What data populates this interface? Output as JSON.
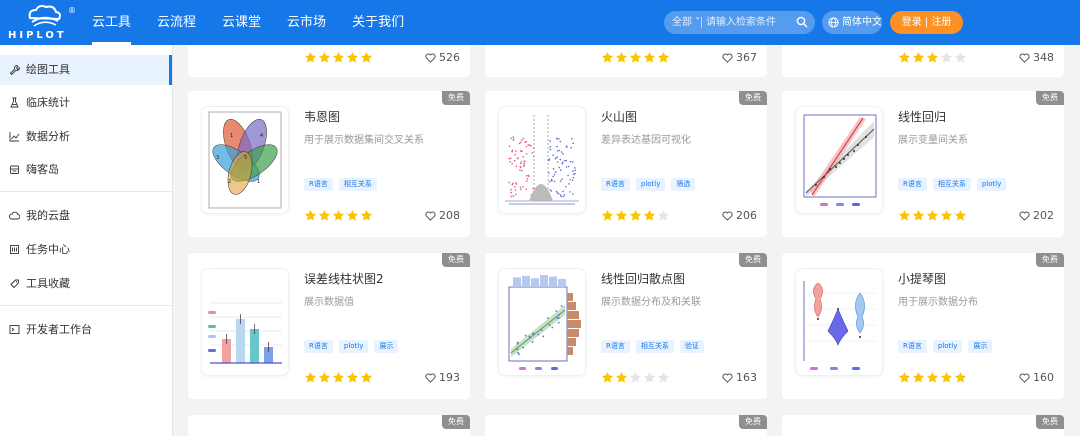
{
  "header": {
    "logo_text": "HIPLOT",
    "logo_reg": "®",
    "nav": [
      {
        "label": "云工具",
        "active": true
      },
      {
        "label": "云流程",
        "active": false
      },
      {
        "label": "云课堂",
        "active": false
      },
      {
        "label": "云市场",
        "active": false
      },
      {
        "label": "关于我们",
        "active": false
      }
    ],
    "search_scope": "全部",
    "search_placeholder": "请输入检索条件",
    "language": "简体中文",
    "login": "登录 | 注册"
  },
  "sidebar": {
    "items": [
      {
        "label": "绘图工具",
        "icon": "wrench-icon",
        "active": true
      },
      {
        "label": "临床统计",
        "icon": "flask-icon",
        "active": false
      },
      {
        "label": "数据分析",
        "icon": "line-chart-icon",
        "active": false
      },
      {
        "label": "嗨客岛",
        "icon": "island-icon",
        "active": false
      },
      {
        "label": "我的云盘",
        "icon": "cloud-icon",
        "active": false
      },
      {
        "label": "任务中心",
        "icon": "task-icon",
        "active": false
      },
      {
        "label": "工具收藏",
        "icon": "bookmark-icon",
        "active": false
      },
      {
        "label": "开发者工作台",
        "icon": "terminal-icon",
        "active": false
      }
    ]
  },
  "colors": {
    "brand": "#1677e8",
    "star_on": "#f7c600",
    "star_off": "#e5e5e5",
    "login": "#ff9124",
    "badge": "#8f8f8f"
  },
  "top_partial": [
    {
      "rating": 5,
      "likes": "526"
    },
    {
      "rating": 5,
      "likes": "367"
    },
    {
      "rating": 3,
      "likes": "348"
    }
  ],
  "cards": [
    {
      "title": "韦恩图",
      "desc": "用于展示数据集间交叉关系",
      "badge": "免费",
      "tags": [
        "R语言",
        "相互关系"
      ],
      "rating": 5,
      "likes": "208",
      "thumb": "venn"
    },
    {
      "title": "火山图",
      "desc": "差异表达基因可视化",
      "badge": "免费",
      "tags": [
        "R语言",
        "plotly",
        "筛选"
      ],
      "rating": 4,
      "likes": "206",
      "thumb": "volcano"
    },
    {
      "title": "线性回归",
      "desc": "展示变量间关系",
      "badge": "免费",
      "tags": [
        "R语言",
        "相互关系",
        "plotly"
      ],
      "rating": 5,
      "likes": "202",
      "thumb": "regression"
    },
    {
      "title": "误差线柱状图2",
      "desc": "展示数据值",
      "badge": "免费",
      "tags": [
        "R语言",
        "plotly",
        "展示"
      ],
      "rating": 5,
      "likes": "193",
      "thumb": "errorbar"
    },
    {
      "title": "线性回归散点图",
      "desc": "展示数据分布及和关联",
      "badge": "免费",
      "tags": [
        "R语言",
        "相互关系",
        "验证"
      ],
      "rating": 2,
      "likes": "163",
      "thumb": "scatter"
    },
    {
      "title": "小提琴图",
      "desc": "用于展示数据分布",
      "badge": "免费",
      "tags": [
        "R语言",
        "plotly",
        "展示"
      ],
      "rating": 5,
      "likes": "160",
      "thumb": "violin"
    }
  ],
  "bottom_partial": [
    {
      "badge": "免费"
    },
    {
      "badge": "免费"
    },
    {
      "badge": "免费"
    }
  ]
}
